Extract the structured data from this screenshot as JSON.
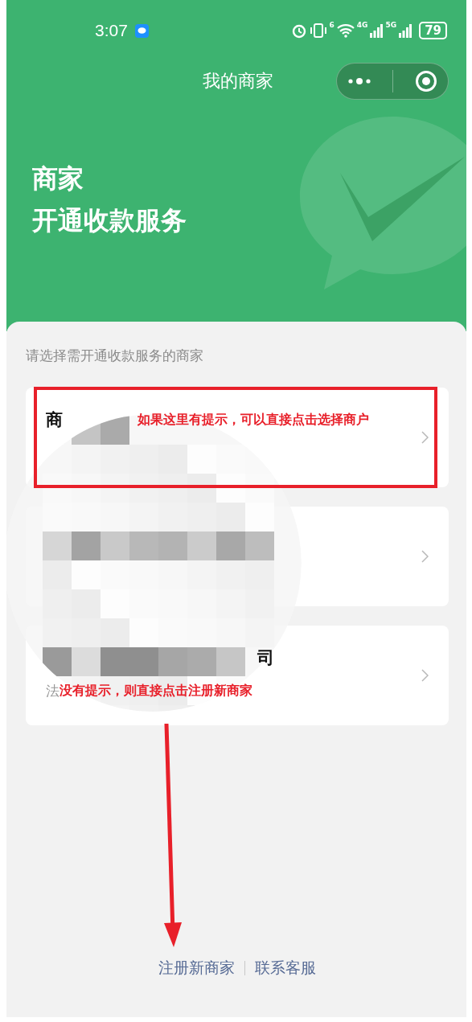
{
  "status_bar": {
    "time": "3:07",
    "wifi_badge": "6",
    "networks": [
      "4G",
      "5G"
    ],
    "battery": "79"
  },
  "nav": {
    "title": "我的商家"
  },
  "hero": {
    "lines": [
      "商家",
      "开通收款服务"
    ]
  },
  "panel": {
    "prompt": "请选择需开通收款服务的商家",
    "merchants": [
      {
        "name": "商",
        "hidden_prefix": false,
        "note": "如果这里有提示，可以直接点击选择商户",
        "highlighted": true
      },
      {
        "highlighted": false
      },
      {
        "name": "司",
        "hidden_prefix": true,
        "subtitle": "法",
        "note": "没有提示，则直接点击注册新商家",
        "highlighted": false
      }
    ],
    "links": [
      "注册新商家",
      "联系客服"
    ]
  }
}
